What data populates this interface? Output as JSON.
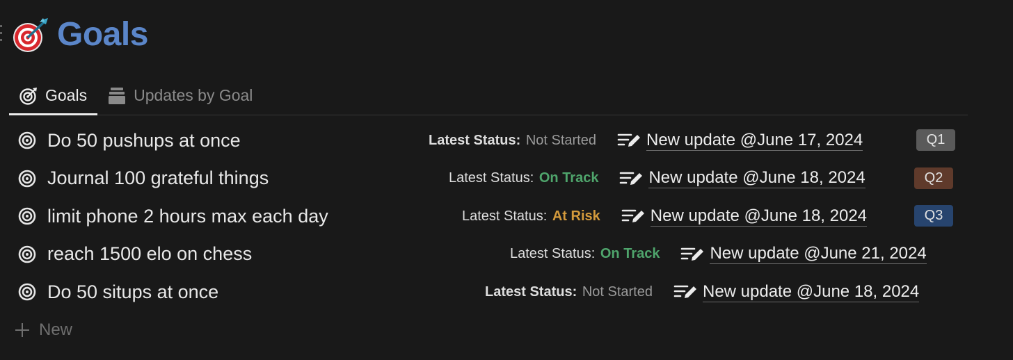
{
  "page": {
    "title": "Goals",
    "icon": "dart-target-icon"
  },
  "tabs": [
    {
      "label": "Goals",
      "icon": "target-icon",
      "active": true
    },
    {
      "label": "Updates by Goal",
      "icon": "stack-icon",
      "active": false
    }
  ],
  "status_label": "Latest Status:",
  "colors": {
    "title": "#5b86c9",
    "not_started": "#9a9a9a",
    "on_track": "#4fa56c",
    "at_risk": "#d49a3c",
    "q1": "#5a5a5a",
    "q2": "#5f3a2b",
    "q3": "#27446e"
  },
  "goals": [
    {
      "title": "Do 50 pushups at once",
      "status": "Not Started",
      "update": "New update @June 17, 2024",
      "quarter": "Q1"
    },
    {
      "title": "Journal 100 grateful things",
      "status": "On Track",
      "update": "New update @June 18, 2024",
      "quarter": "Q2"
    },
    {
      "title": "limit phone 2 hours max each day",
      "status": "At Risk",
      "update": "New update @June 18, 2024",
      "quarter": "Q3"
    },
    {
      "title": "reach 1500 elo on chess",
      "status": "On Track",
      "update": "New update @June 21, 2024",
      "quarter": ""
    },
    {
      "title": "Do 50 situps at once",
      "status": "Not Started",
      "update": "New update @June 18, 2024",
      "quarter": ""
    }
  ],
  "new_button": {
    "label": "New",
    "icon": "plus-icon"
  }
}
